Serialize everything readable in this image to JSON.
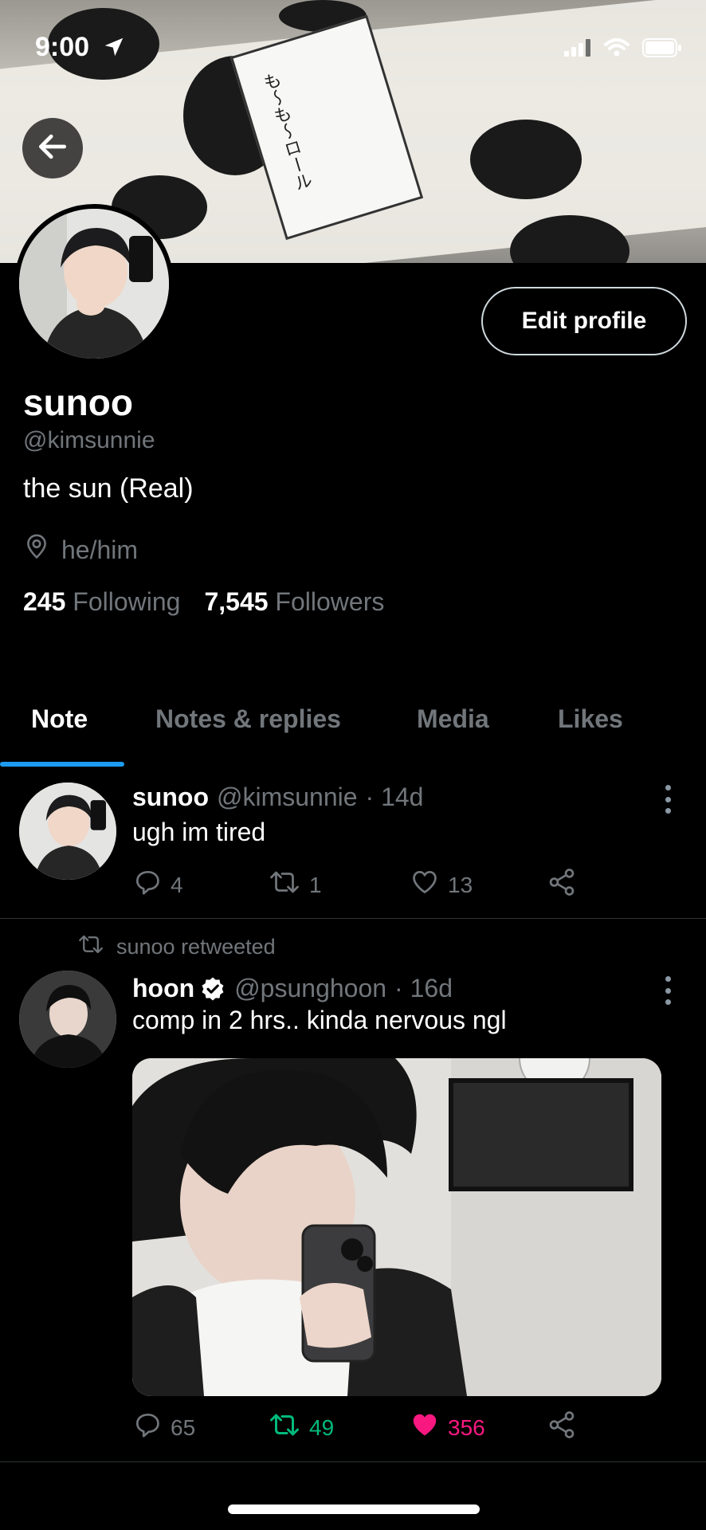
{
  "status": {
    "time": "9:00"
  },
  "banner": {
    "label_text": "も〜も〜ロール"
  },
  "profile": {
    "name": "sunoo",
    "handle": "@kimsunnie",
    "bio": "the sun (Real)",
    "location": "he/him",
    "edit_label": "Edit profile",
    "following_count": "245",
    "following_label": "Following",
    "followers_count": "7,545",
    "followers_label": "Followers"
  },
  "tabs": [
    {
      "label": "Note",
      "active": true
    },
    {
      "label": "Notes & replies",
      "active": false
    },
    {
      "label": "Media",
      "active": false
    },
    {
      "label": "Likes",
      "active": false
    }
  ],
  "tweets": [
    {
      "name": "sunoo",
      "handle": "@kimsunnie",
      "time": "· 14d",
      "text": "ugh im tired",
      "replies": "4",
      "retweets": "1",
      "likes": "13"
    },
    {
      "retweeted_by": "sunoo retweeted",
      "name": "hoon",
      "verified": true,
      "handle": "@psunghoon",
      "time": "· 16d",
      "text": "comp in 2 hrs.. kinda nervous ngl",
      "replies": "65",
      "retweets": "49",
      "likes": "356",
      "colors": {
        "retweet": "#00ba7c",
        "like": "#f91880"
      }
    }
  ]
}
